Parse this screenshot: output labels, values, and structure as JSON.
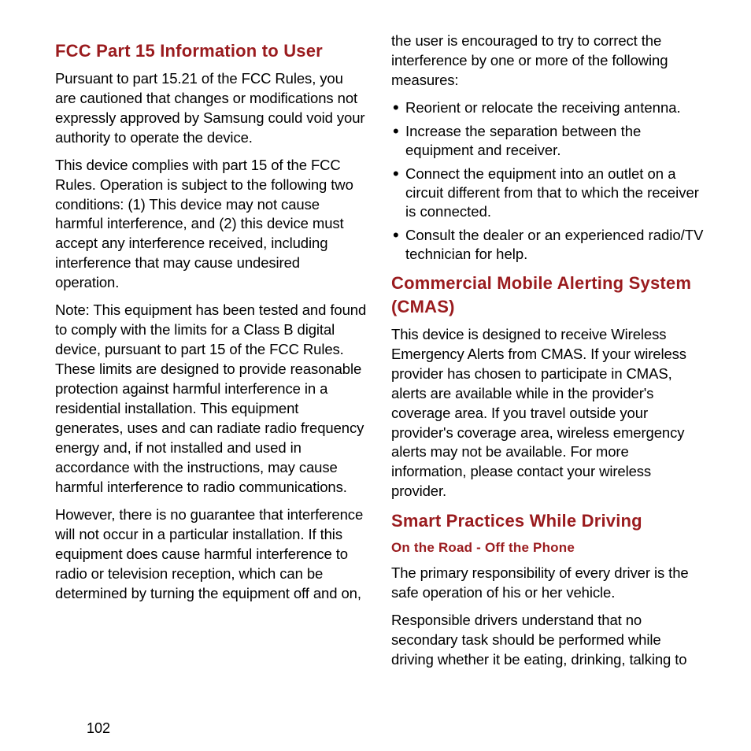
{
  "left": {
    "heading1": "FCC Part 15 Information to User",
    "p1": "Pursuant to part 15.21 of the FCC Rules, you are cautioned that changes or modifications not expressly approved by Samsung could void your authority to operate the device.",
    "p2": "This device complies with part 15 of the FCC Rules. Operation is subject to the following two conditions: (1) This device may not cause harmful interference, and (2) this device must accept any interference received, including interference that may cause undesired operation.",
    "p3": "Note: This equipment has been tested and found to comply with the limits for a Class B digital device, pursuant to part 15 of the FCC Rules. These limits are designed to provide reasonable protection against harmful interference in a residential installation. This equipment generates, uses and can radiate radio frequency energy and, if not installed and used in accordance with the instructions, may cause harmful interference to radio communications.",
    "p4": "However, there is no guarantee that interference will not occur in a particular installation. If this equipment does cause harmful interference to radio or television reception, which can be determined by turning the equipment off and on,"
  },
  "right": {
    "p1": "the user is encouraged to try to correct the interference by one or more of the following measures:",
    "bullets": [
      "Reorient or relocate the receiving antenna.",
      "Increase the separation between the equipment and receiver.",
      "Connect the equipment into an outlet on a circuit different from that to which the receiver is connected.",
      "Consult the dealer or an experienced radio/TV technician for help."
    ],
    "heading2": "Commercial Mobile Alerting System (CMAS)",
    "p2": "This device is designed to receive Wireless Emergency Alerts from CMAS. If your wireless provider has chosen to participate in CMAS, alerts are available while in the provider's coverage area. If you travel outside your provider's coverage area, wireless emergency alerts may not be available. For more information, please contact your wireless provider.",
    "heading3": "Smart Practices While Driving",
    "subhead": "On the Road - Off the Phone",
    "p3": "The primary responsibility of every driver is the safe operation of his or her vehicle.",
    "p4": "Responsible drivers understand that no secondary task should be performed while driving whether it be eating, drinking, talking to"
  },
  "page_number": "102"
}
